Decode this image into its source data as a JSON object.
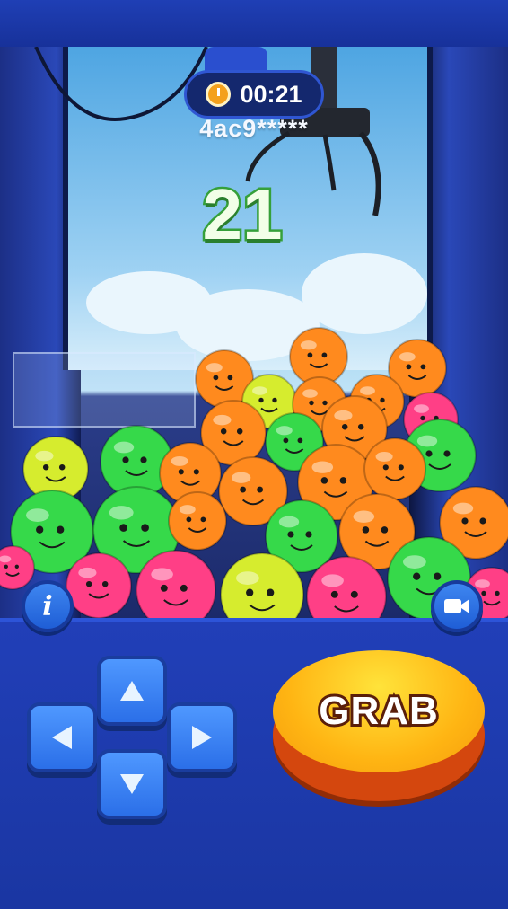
{
  "timer": {
    "icon": "stopwatch-icon",
    "value": "00:21"
  },
  "player": {
    "id": "4ac9*****"
  },
  "tries": {
    "count": "21"
  },
  "controls": {
    "info_label": "i",
    "info_icon": "info-icon",
    "camera_icon": "video-camera-icon",
    "dpad": {
      "up_icon": "arrow-up-icon",
      "left_icon": "arrow-left-icon",
      "right_icon": "arrow-right-icon",
      "down_icon": "arrow-down-icon"
    },
    "grab_label": "GRAB"
  },
  "colors": {
    "panel": "#1a36a2",
    "grab": "#ffb513",
    "dpad": "#3b82f0",
    "ball_green": "#36d94a",
    "ball_orange": "#ff8a1e",
    "ball_pink": "#ff3f86",
    "ball_yellow": "#d6ec2e"
  }
}
